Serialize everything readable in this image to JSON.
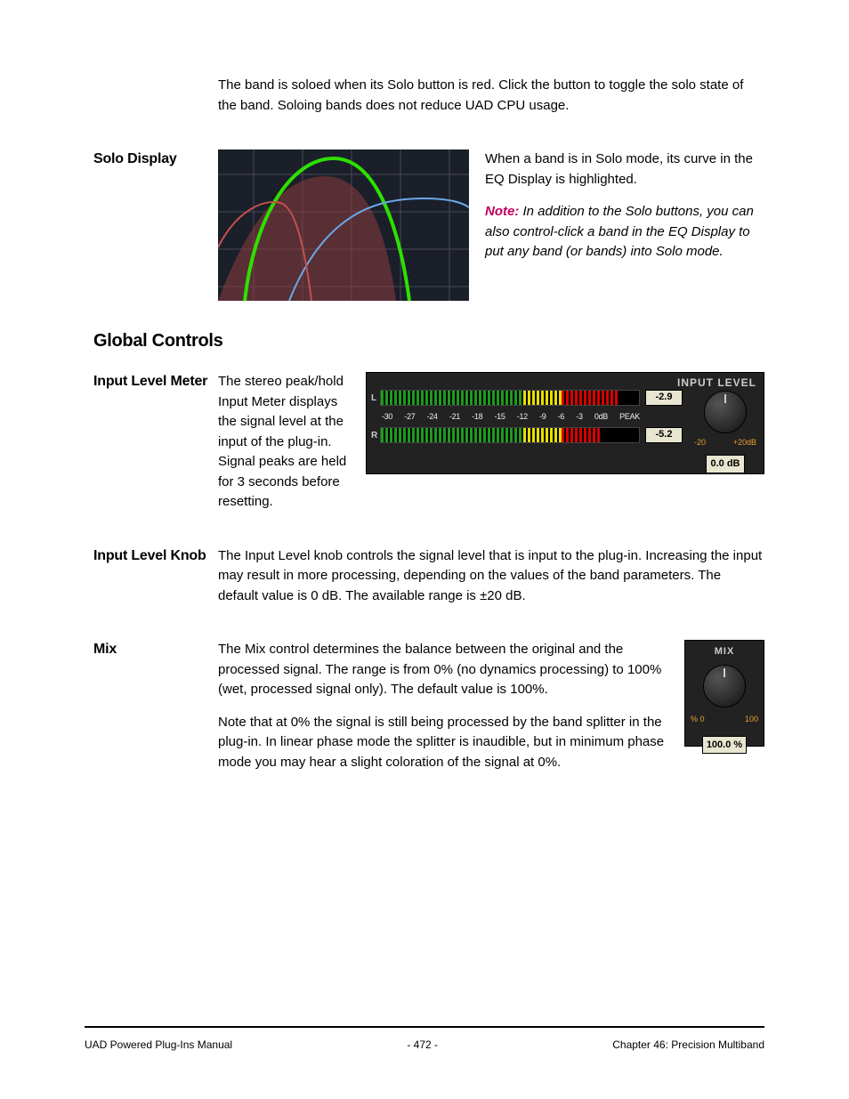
{
  "intro_para": "The band is soloed when its Solo button is red. Click the button to toggle the solo state of the band. Soloing bands does not reduce UAD CPU usage.",
  "solo_display": {
    "label": "Solo Display",
    "p1": "When a band is in Solo mode, its curve in the EQ Display is highlighted.",
    "note_lead": "Note:",
    "note_body": " In addition to the Solo buttons, you can also control-click a band in the EQ Display to put any band (or bands) into Solo mode."
  },
  "section_head": "Global Controls",
  "input_meter": {
    "label": "Input Level Meter",
    "lead_text": "The stereo peak/hold Input Meter displays the signal level at the input of the plug-in. Signal peaks are held for 3 seconds before resetting.",
    "fig": {
      "title": "INPUT LEVEL",
      "channels": [
        "L",
        "R"
      ],
      "peak_values": [
        "-2.9",
        "-5.2"
      ],
      "scale": [
        "-30",
        "-27",
        "-24",
        "-21",
        "-18",
        "-15",
        "-12",
        "-9",
        "-6",
        "-3",
        "0dB",
        "PEAK"
      ],
      "knob_scale": [
        "-20",
        "+20dB"
      ],
      "knob_value": "0.0 dB"
    }
  },
  "input_knob": {
    "label": "Input Level Knob",
    "text": "The Input Level knob controls the signal level that is input to the plug-in. Increasing the input may result in more processing, depending on the values of the band parameters. The default value is 0 dB. The available range is ±20 dB."
  },
  "mix": {
    "label": "Mix",
    "p1": "The Mix control determines the balance between the original and the processed signal. The range is from 0% (no dynamics processing) to 100% (wet, processed signal only). The default value is 100%.",
    "p2": "Note that at 0% the signal is still being processed by the band splitter in the plug-in. In linear phase mode the splitter is inaudible, but in minimum phase mode you may hear a slight coloration of the signal at 0%.",
    "fig": {
      "title": "MIX",
      "scale": [
        "% 0",
        "100"
      ],
      "value": "100.0 %"
    }
  },
  "footer": {
    "left": "UAD Powered Plug-Ins Manual",
    "center": "- 472 -",
    "right": "Chapter 46: Precision Multiband"
  }
}
